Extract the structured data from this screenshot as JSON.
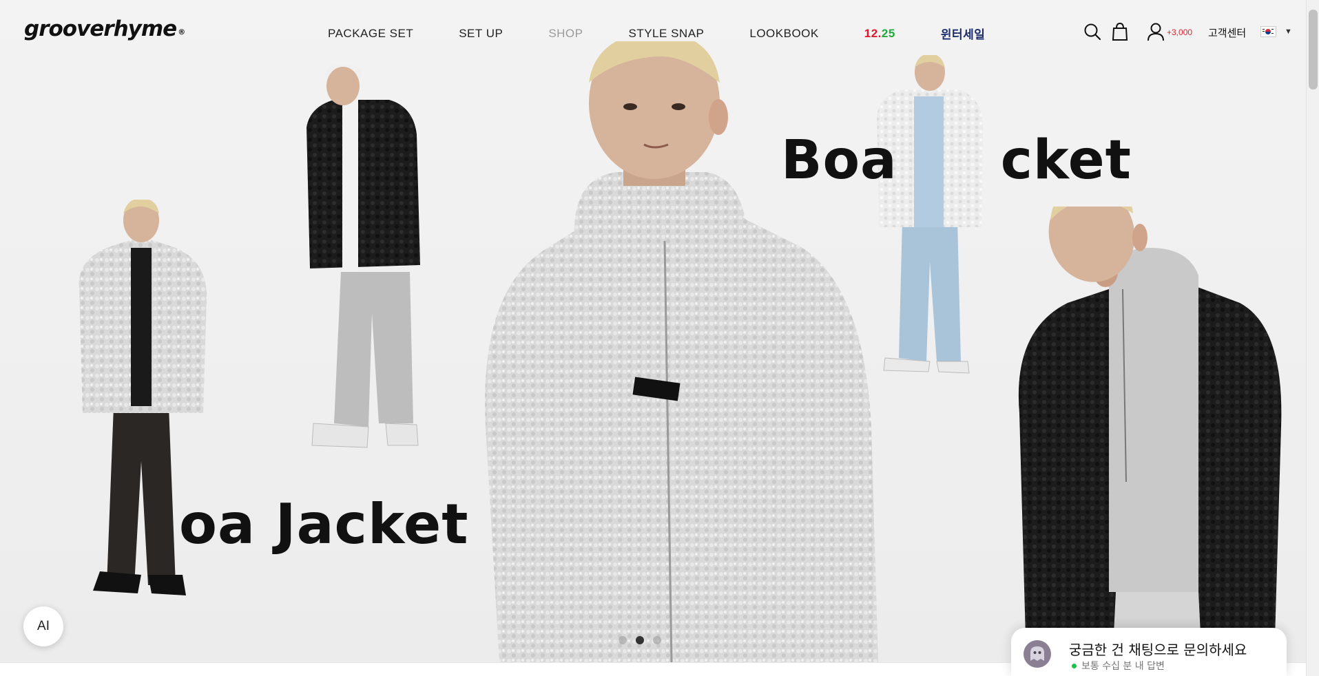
{
  "brand": {
    "logo_text": "grooverhyme",
    "registered_mark": "®"
  },
  "nav": {
    "items": [
      {
        "label": "PACKAGE SET"
      },
      {
        "label": "SET UP"
      },
      {
        "label": "SHOP"
      },
      {
        "label": "STYLE SNAP"
      },
      {
        "label": "LOOKBOOK"
      }
    ],
    "promo_date_part1": "12.",
    "promo_date_part2": "25",
    "winter_sale": "윈터세일",
    "promo_colors": {
      "red": "#e0182d",
      "green": "#1fa83b",
      "navy": "#1a2a6b"
    }
  },
  "header_right": {
    "search_icon": "search-icon",
    "cart_icon": "shopping-bag-icon",
    "account_icon": "user-icon",
    "points": "+3,000",
    "customer_center": "고객센터",
    "language_flag": "korea-flag-icon"
  },
  "hero": {
    "title_left": "oa Jacket",
    "title_right_a": "Boa",
    "title_right_b": "cket",
    "slides_count": 3,
    "active_slide": 2
  },
  "ai_button": {
    "label": "AI"
  },
  "chat_widget": {
    "title": "궁금한 건 채팅으로 문의하세요",
    "subtitle": "보통 수십 분 내 답변",
    "status_color": "#1fbf4d"
  }
}
